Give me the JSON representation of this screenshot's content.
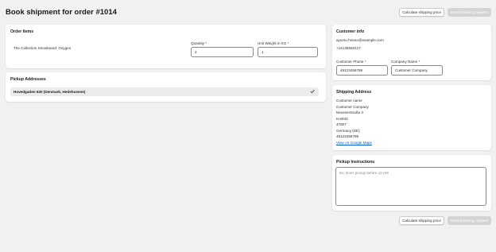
{
  "header": {
    "title": "Book shipment for order #1014",
    "calculate_label": "Calculate shipping price",
    "send_label": "Send booking request"
  },
  "order_items": {
    "title": "Order Items",
    "product_name": "The Collection Snowboard: Oxygen",
    "quantity_label": "Quantity",
    "quantity_value": "2",
    "weight_label": "Unit Weight in KG",
    "weight_value": "1",
    "required_mark": "*"
  },
  "pickup_addresses": {
    "title": "Pickup Addresses",
    "selected": "Hovedgaden 630 (Denmark, Hedehusene)"
  },
  "customer_info": {
    "title": "Customer info",
    "email": "ayumu.hirano@example.com",
    "phone_display": "+16135550127",
    "phone_label": "Customer Phone",
    "phone_value": "49123456789",
    "company_label": "Company Name",
    "company_value": "Customer Company",
    "required_mark": "*"
  },
  "shipping_address": {
    "title": "Shipping Address",
    "lines": [
      "Customer name",
      "Customer Company",
      "Neusserstraße 3",
      "Krefeld",
      "47807",
      "Germany (DE)",
      "49123456789"
    ],
    "map_link": "View on Google Maps"
  },
  "pickup_instructions": {
    "title": "Pickup Instructions",
    "placeholder": "Ex: Don't pickup before 10 AM"
  },
  "footer": {
    "calculate_label": "Calculate shipping price",
    "send_label": "Send booking request"
  }
}
